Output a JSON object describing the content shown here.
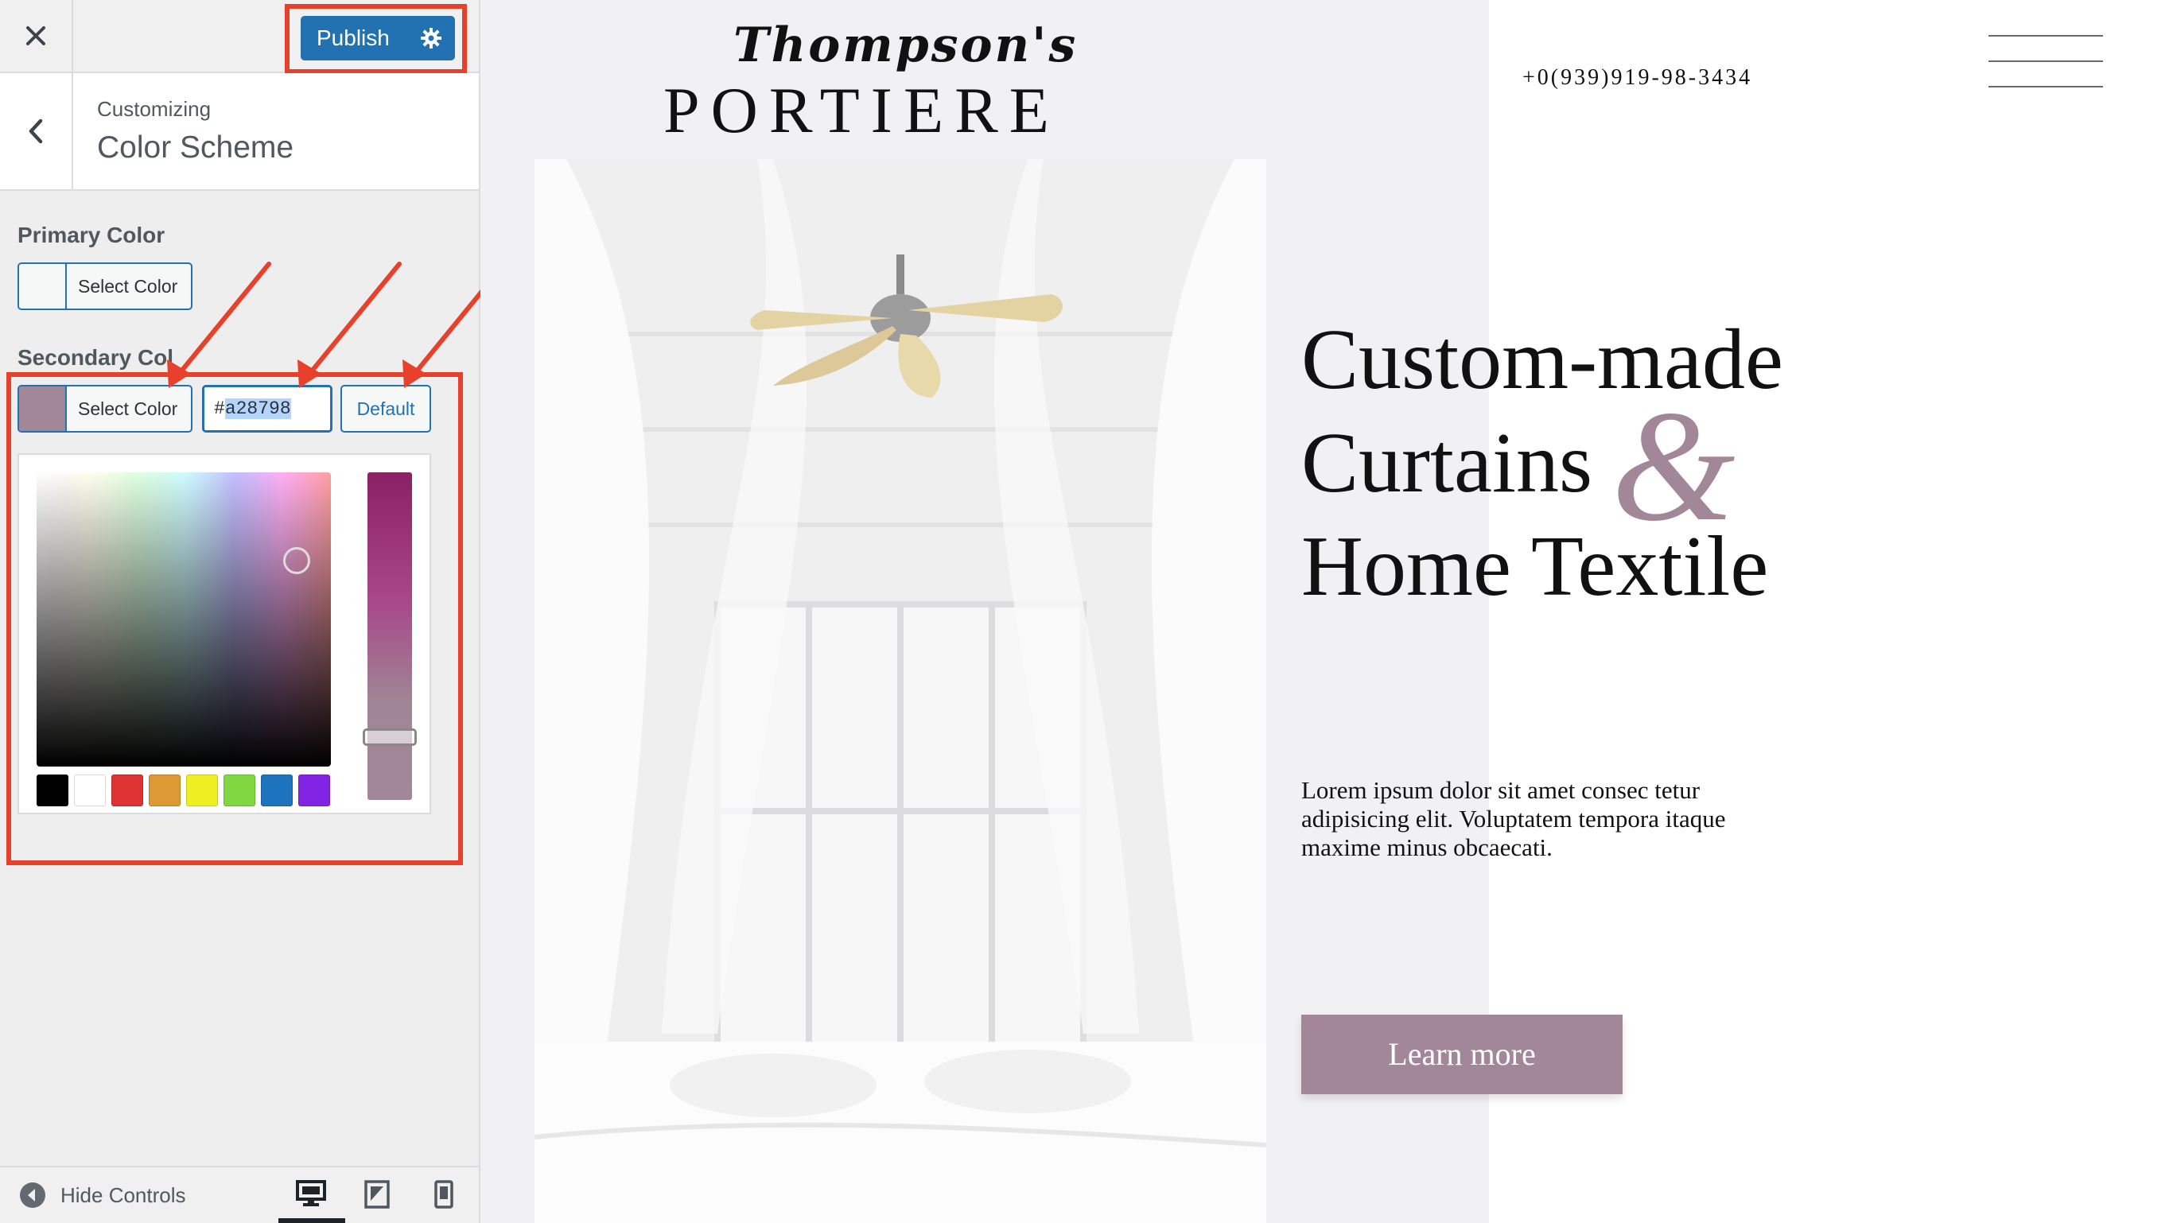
{
  "sidebar": {
    "publish_label": "Publish",
    "breadcrumb": "Customizing",
    "section_title": "Color Scheme",
    "primary": {
      "label": "Primary Color",
      "button_label": "Select Color",
      "swatch_color": "#f6f7f7"
    },
    "secondary": {
      "label": "Secondary Col",
      "button_label": "Select Color",
      "swatch_color": "#a28798",
      "hex_prefix": "#",
      "hex_selected": "a28798",
      "default_label": "Default"
    },
    "palette": [
      "#000000",
      "#ffffff",
      "#dd3333",
      "#dd9933",
      "#eeee22",
      "#81d742",
      "#1e73be",
      "#8224e3"
    ],
    "footer": {
      "hide_controls": "Hide Controls"
    }
  },
  "preview": {
    "brand_script": "Thompson's",
    "brand_main": "PORTIERE",
    "phone": "+0(939)919-98-3434",
    "headline_line1": "Custom-made",
    "headline_line2": "Curtains",
    "headline_amp": "&",
    "headline_line3": "Home Textile",
    "body": "Lorem ipsum dolor sit amet consec tetur adipisicing elit. Voluptatem tempora itaque maxime minus obcaecati.",
    "cta_label": "Learn more"
  },
  "colors": {
    "accent": "#2271b1",
    "highlight": "#e8412b",
    "secondary_color": "#a28798"
  }
}
